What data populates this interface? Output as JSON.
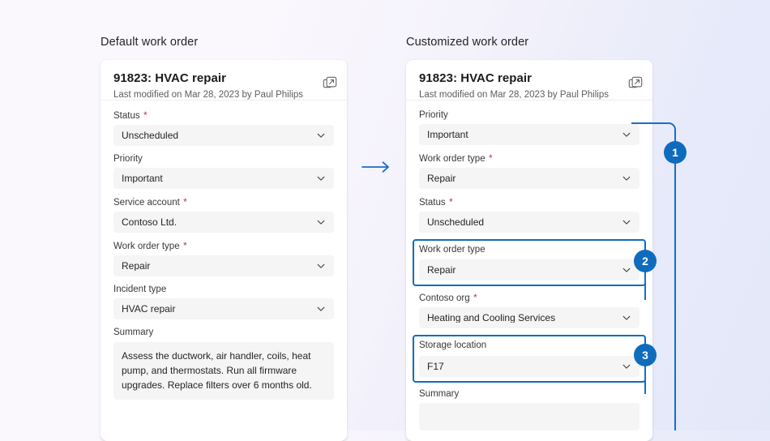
{
  "colors": {
    "accent": "#0f6cbd",
    "required_asterisk": "#c4314b",
    "card_background": "#ffffff",
    "control_background": "#f5f5f5",
    "page_gradient_start": "#fbf8fd",
    "page_gradient_end": "#e3e8f8",
    "title_text": "#1b1b1b",
    "label_text": "#383838",
    "subtitle_text": "#5d5d5d"
  },
  "captions": {
    "left": "Default work order",
    "right": "Customized work order"
  },
  "icons": {
    "popout": "open-in-new-window-icon",
    "chevron": "chevron-down-icon",
    "flow_arrow": "arrow-right-icon"
  },
  "flow": {
    "arrow_label": "transforms into"
  },
  "default_card": {
    "title": "91823: HVAC repair",
    "subtitle": "Last modified on Mar 28, 2023 by Paul Philips",
    "popout_label": "Open in new window",
    "fields": [
      {
        "label": "Status",
        "required": true,
        "value": "Unscheduled",
        "type": "dropdown"
      },
      {
        "label": "Priority",
        "required": false,
        "value": "Important",
        "type": "dropdown"
      },
      {
        "label": "Service account",
        "required": true,
        "value": "Contoso Ltd.",
        "type": "dropdown"
      },
      {
        "label": "Work order type",
        "required": true,
        "value": "Repair",
        "type": "dropdown"
      },
      {
        "label": "Incident type",
        "required": false,
        "value": "HVAC repair",
        "type": "dropdown"
      },
      {
        "label": "Summary",
        "required": false,
        "value": "Assess the ductwork, air handler, coils, heat pump, and thermostats. Run all firmware upgrades. Replace filters over 6 months old.",
        "type": "textarea"
      }
    ]
  },
  "customized_card": {
    "title": "91823: HVAC repair",
    "subtitle": "Last modified on Mar 28, 2023 by Paul Philips",
    "popout_label": "Open in new window",
    "fields": [
      {
        "label": "Priority",
        "required": false,
        "value": "Important",
        "type": "dropdown",
        "highlighted": false
      },
      {
        "label": "Work order type",
        "required": true,
        "value": "Repair",
        "type": "dropdown",
        "highlighted": false
      },
      {
        "label": "Status",
        "required": true,
        "value": "Unscheduled",
        "type": "dropdown",
        "highlighted": false
      },
      {
        "label": "Work order type",
        "required": false,
        "value": "Repair",
        "type": "dropdown",
        "highlighted": true
      },
      {
        "label": "Contoso org",
        "required": true,
        "value": "Heating and Cooling Services",
        "type": "dropdown",
        "highlighted": false
      },
      {
        "label": "Storage location",
        "required": false,
        "value": "F17",
        "type": "dropdown",
        "highlighted": true
      },
      {
        "label": "Summary",
        "required": false,
        "value": "",
        "type": "textarea",
        "highlighted": false
      }
    ]
  },
  "callouts": [
    {
      "number": "1",
      "target": "field-order-reordered"
    },
    {
      "number": "2",
      "target": "field-work-order-type-duplicate"
    },
    {
      "number": "3",
      "target": "field-storage-location"
    }
  ]
}
